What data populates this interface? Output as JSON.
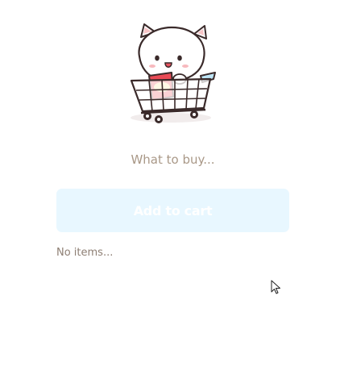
{
  "illustration": {
    "name": "cat-in-shopping-cart-icon"
  },
  "form": {
    "placeholder": "What to buy...",
    "value": "",
    "add_button_label": "Add to cart"
  },
  "list": {
    "empty_text": "No items..."
  },
  "colors": {
    "button_bg": "#e8f7ff",
    "button_text": "#ffffff",
    "placeholder": "#a99887",
    "empty_text": "#8e7f74"
  }
}
